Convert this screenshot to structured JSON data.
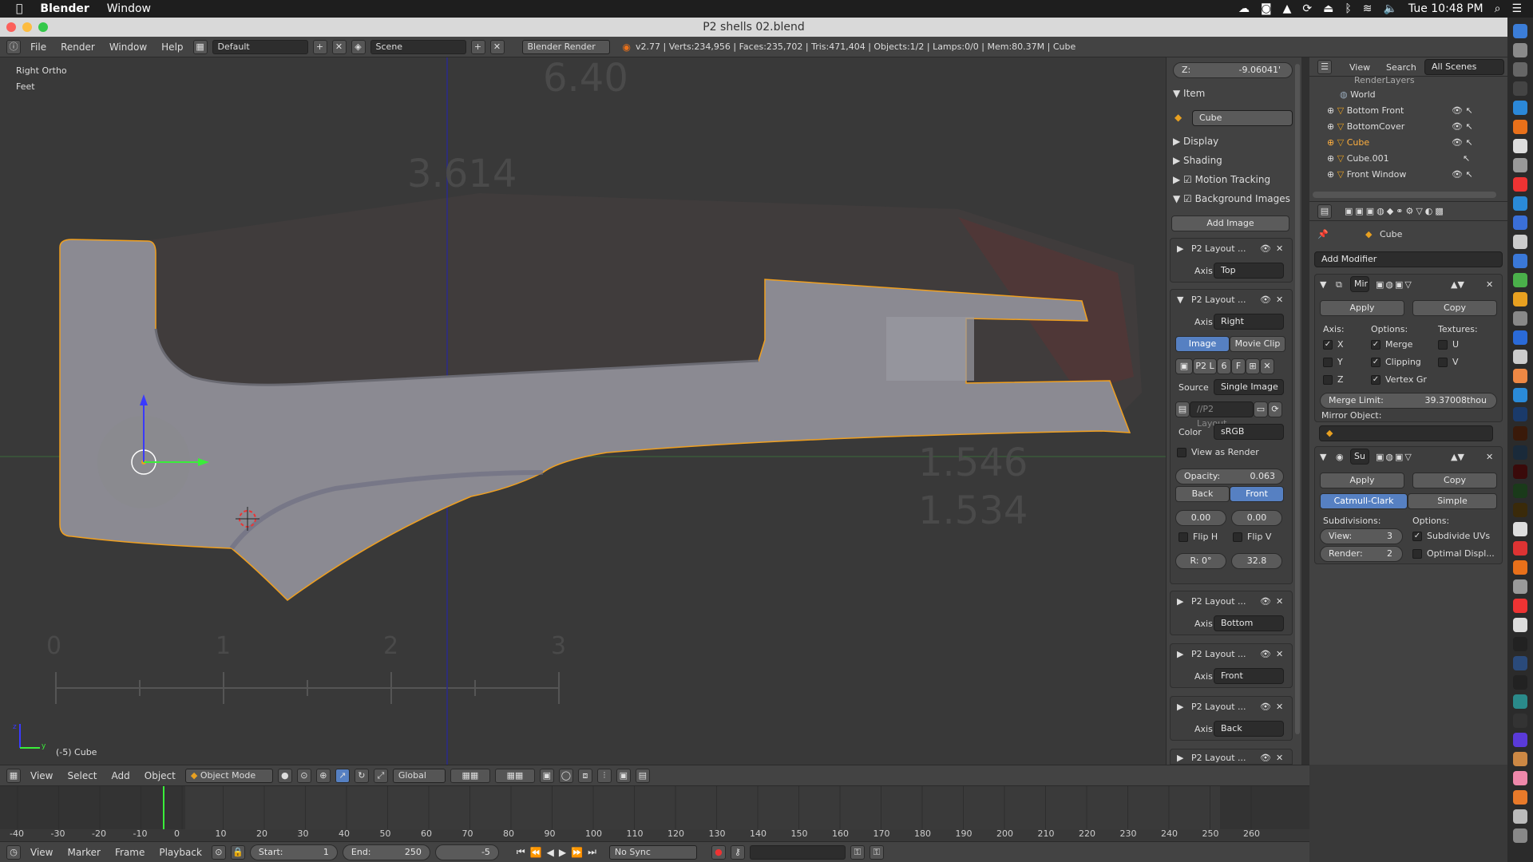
{
  "macbar": {
    "app": "Blender",
    "menu": "Window",
    "clock": "Tue 10:48 PM"
  },
  "window": {
    "title": "P2 shells 02.blend"
  },
  "infobar": {
    "menus": [
      "File",
      "Render",
      "Window",
      "Help"
    ],
    "layout": "Default",
    "scene": "Scene",
    "engine": "Blender Render",
    "stats": "v2.77 | Verts:234,956 | Faces:235,702 | Tris:471,404 | Objects:1/2 | Lamps:0/0 | Mem:80.37M | Cube"
  },
  "viewport": {
    "view_label": "Right Ortho",
    "units": "Feet",
    "object_label": "(-5) Cube",
    "ref_numbers": [
      "6.40",
      "3.614",
      "1.546",
      "1.534"
    ],
    "ruler": [
      "0",
      "1",
      "2",
      "3"
    ],
    "axis_y": "y",
    "axis_z": "z"
  },
  "npanel": {
    "z_label": "Z:",
    "z_value": "-9.06041'",
    "item_header": "Item",
    "item_name": "Cube",
    "display": "Display",
    "shading": "Shading",
    "motion_tracking": "Motion Tracking",
    "background_images": "Background Images",
    "add_image": "Add Image",
    "layout_name": "P2 Layout ...",
    "axis_label": "Axis:",
    "axes": [
      "Top",
      "Right",
      "Bottom",
      "Front",
      "Back"
    ],
    "image_tab": "Image",
    "movie_tab": "Movie Clip",
    "img_field_1": "P2 L",
    "img_field_2": "6",
    "img_field_3": "F",
    "source_label": "Source",
    "source": "Single Image",
    "path": "//P2 Layout...",
    "color_label": "Color",
    "color_space": "sRGB",
    "view_as_render": "View as Render",
    "opacity_label": "Opacity:",
    "opacity": "0.063",
    "back": "Back",
    "front": "Front",
    "off_x": "0.00",
    "off_y": "0.00",
    "flip_h": "Flip H",
    "flip_v": "Flip V",
    "rot": "R: 0°",
    "size": "32.8"
  },
  "outliner": {
    "view": "View",
    "search": "Search",
    "scope": "All Scenes",
    "items": [
      "RenderLayers",
      "World",
      "Bottom Front",
      "BottomCover",
      "Cube",
      "Cube.001",
      "Front Window"
    ]
  },
  "props": {
    "object": "Cube",
    "add_modifier": "Add Modifier",
    "mirror": {
      "name": "Mir",
      "apply": "Apply",
      "copy": "Copy",
      "axis": "Axis:",
      "options": "Options:",
      "textures": "Textures:",
      "x": "X",
      "y": "Y",
      "z": "Z",
      "merge": "Merge",
      "clipping": "Clipping",
      "vertex_groups": "Vertex Gr",
      "u": "U",
      "v": "V",
      "merge_limit_label": "Merge Limit:",
      "merge_limit": "39.37008thou",
      "mirror_object": "Mirror Object:"
    },
    "subsurf": {
      "name": "Su",
      "apply": "Apply",
      "copy": "Copy",
      "catmull": "Catmull-Clark",
      "simple": "Simple",
      "subdivisions": "Subdivisions:",
      "options": "Options:",
      "view_label": "View:",
      "view": "3",
      "render_label": "Render:",
      "render": "2",
      "subdivide_uvs": "Subdivide UVs",
      "optimal": "Optimal Displ..."
    }
  },
  "vheader": {
    "menus": [
      "View",
      "Select",
      "Add",
      "Object"
    ],
    "mode": "Object Mode",
    "orientation": "Global"
  },
  "timeline": {
    "ticks": [
      "-40",
      "-30",
      "-20",
      "-10",
      "0",
      "10",
      "20",
      "30",
      "40",
      "50",
      "60",
      "70",
      "80",
      "90",
      "100",
      "110",
      "120",
      "130",
      "140",
      "150",
      "160",
      "170",
      "180",
      "190",
      "200",
      "210",
      "220",
      "230",
      "240",
      "250",
      "260"
    ]
  },
  "tlheader": {
    "menus": [
      "View",
      "Marker",
      "Frame",
      "Playback"
    ],
    "start_label": "Start:",
    "start": "1",
    "end_label": "End:",
    "end": "250",
    "current": "-5",
    "sync": "No Sync"
  }
}
